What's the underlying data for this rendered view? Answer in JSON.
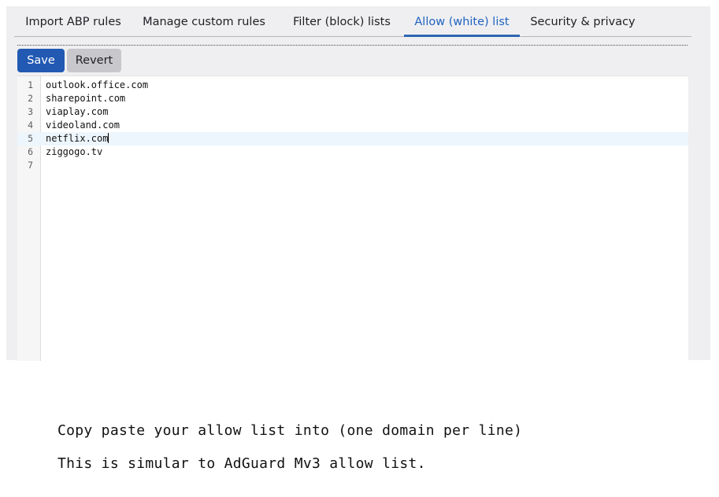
{
  "tabs": [
    {
      "label": "Import ABP rules",
      "active": false
    },
    {
      "label": "Manage custom rules",
      "active": false
    },
    {
      "label": "Filter (block) lists",
      "active": false
    },
    {
      "label": "Allow (white) list",
      "active": true
    },
    {
      "label": "Security & privacy",
      "active": false
    }
  ],
  "toolbar": {
    "save_label": "Save",
    "revert_label": "Revert"
  },
  "editor": {
    "current_line": 5,
    "lines": [
      {
        "number": "1",
        "text": "outlook.office.com"
      },
      {
        "number": "2",
        "text": "sharepoint.com"
      },
      {
        "number": "3",
        "text": "viaplay.com"
      },
      {
        "number": "4",
        "text": "videoland.com"
      },
      {
        "number": "5",
        "text": "netflix.com"
      },
      {
        "number": "6",
        "text": "ziggogo.tv"
      },
      {
        "number": "7",
        "text": ""
      }
    ]
  },
  "instructions": {
    "line1": "Copy paste your allow list into (one domain per line)",
    "line2": "This is simular to AdGuard Mv3 allow list."
  },
  "colors": {
    "accent": "#1f63c0",
    "save_button": "#2159b3",
    "revert_button": "#c8c8cc",
    "panel_bg": "#efeff1",
    "current_line_bg": "#edf6fd"
  }
}
